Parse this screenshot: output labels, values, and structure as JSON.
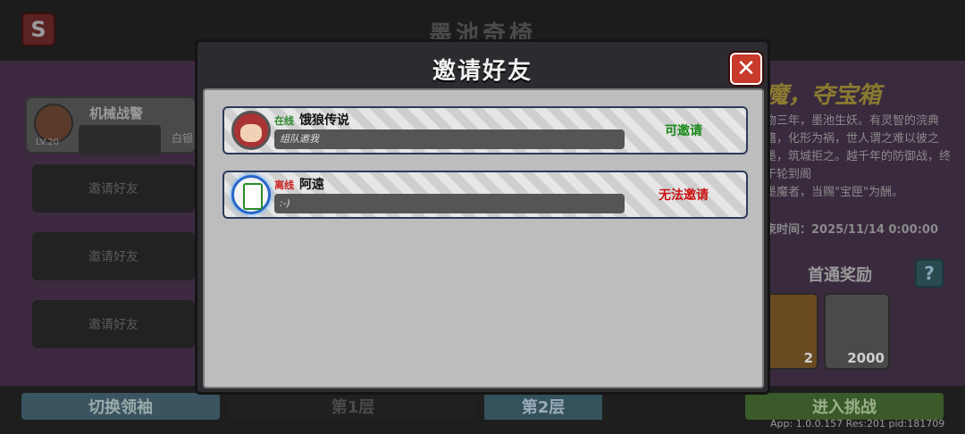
{
  "background": {
    "title": "墨池奇椅",
    "back_icon": "back-arrow-icon",
    "leader": {
      "name": "机械战警",
      "level": "LV.20",
      "rank": "白银"
    },
    "invite_slots": [
      "邀请好友",
      "邀请好友",
      "邀请好友"
    ],
    "switch_leader_label": "切换领袖",
    "floor_tabs": [
      "第1层",
      "第2层"
    ],
    "enter_label": "进入挑战",
    "version_text": "App: 1.0.0.157 Res:201 pid:181709",
    "right_panel": {
      "headline": "魔，夺宝箱",
      "description": "物三年，墨池生妖。有灵智的浣典籍，化形为祸，世人谓之难以彼之墨，筑城拒之。越千年的防御战，终于轮到阁",
      "reward_note": "墨魔者，当赐\"宝匣\"为酬。",
      "end_time": "束时间：2025/11/14 0:00:00",
      "reward_title": "首通奖励",
      "rewards": [
        {
          "count": "2"
        },
        {
          "count": "2000"
        }
      ]
    }
  },
  "modal": {
    "title": "邀请好友",
    "close_icon": "close-icon",
    "friends": [
      {
        "status": "在线",
        "status_type": "online",
        "name": "饿狼传说",
        "signature": "组队邀我",
        "action": "可邀请",
        "action_type": "can"
      },
      {
        "status": "离线",
        "status_type": "offline",
        "name": "阿遠",
        "signature": ":-)",
        "action": "无法邀请",
        "action_type": "cannot"
      }
    ]
  },
  "colors": {
    "online": "#2a8a2a",
    "offline": "#cc1111",
    "close": "#c83a2a"
  }
}
